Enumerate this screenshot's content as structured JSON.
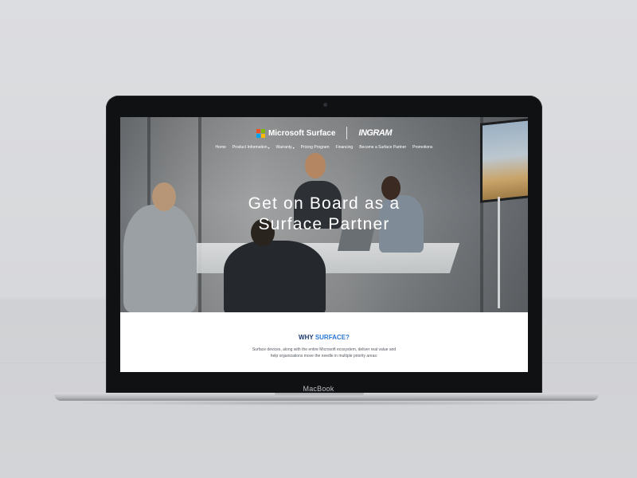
{
  "device": {
    "brand_label": "MacBook"
  },
  "site": {
    "brand_name": "Microsoft Surface",
    "partner_logo": "INGRAM",
    "ms_logo_colors": [
      "#f25022",
      "#7fba00",
      "#00a4ef",
      "#ffb900"
    ]
  },
  "nav": {
    "items": [
      {
        "label": "Home",
        "has_dropdown": false
      },
      {
        "label": "Product Information",
        "has_dropdown": true
      },
      {
        "label": "Warranty",
        "has_dropdown": true
      },
      {
        "label": "Pricing Program",
        "has_dropdown": false
      },
      {
        "label": "Financing",
        "has_dropdown": false
      },
      {
        "label": "Become a Surface Partner",
        "has_dropdown": false
      },
      {
        "label": "Promotions",
        "has_dropdown": false
      }
    ]
  },
  "hero": {
    "title_line1": "Get on Board as a",
    "title_line2": "Surface Partner"
  },
  "why": {
    "title_prefix": "WHY",
    "title_accent": "SURFACE?",
    "body_line1": "Surface devices, along with the entire Microsoft ecosystem, deliver real value and",
    "body_line2": "help organizations move the needle in multiple priority areas:"
  },
  "colors": {
    "accent": "#2b78d4",
    "heading_navy": "#1b3a6b"
  }
}
